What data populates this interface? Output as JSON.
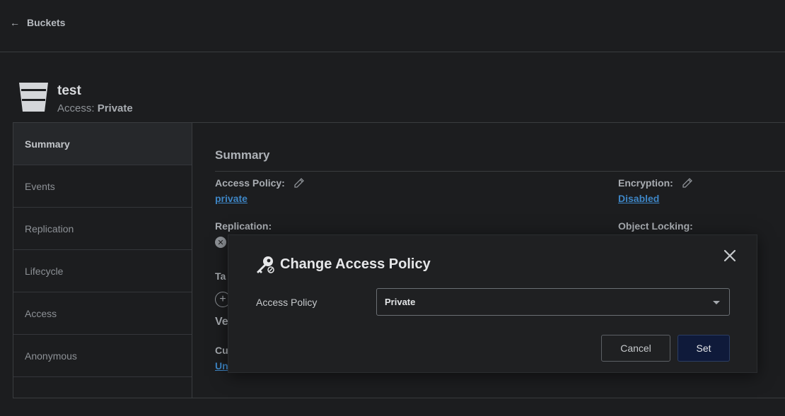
{
  "nav": {
    "back_label": "Buckets"
  },
  "bucket": {
    "name": "test",
    "access_prefix": "Access:",
    "access_value": "Private"
  },
  "sidebar": {
    "items": [
      {
        "label": "Summary",
        "active": true
      },
      {
        "label": "Events"
      },
      {
        "label": "Replication"
      },
      {
        "label": "Lifecycle"
      },
      {
        "label": "Access"
      },
      {
        "label": "Anonymous"
      }
    ]
  },
  "summary": {
    "title": "Summary",
    "access_policy_label": "Access Policy:",
    "access_policy_value": "private",
    "encryption_label": "Encryption:",
    "encryption_value": "Disabled",
    "replication_label": "Replication:",
    "object_locking_label": "Object Locking:",
    "tags_partial": "Ta",
    "versioning_partial": "Ve",
    "current_partial": "Cu",
    "link_partial": "Un"
  },
  "modal": {
    "title": "Change Access Policy",
    "field_label": "Access Policy",
    "select_value": "Private",
    "cancel_label": "Cancel",
    "set_label": "Set"
  },
  "colors": {
    "background": "#1c1d1f",
    "link": "#3e86c6",
    "primary_button": "#0f1a3a"
  }
}
